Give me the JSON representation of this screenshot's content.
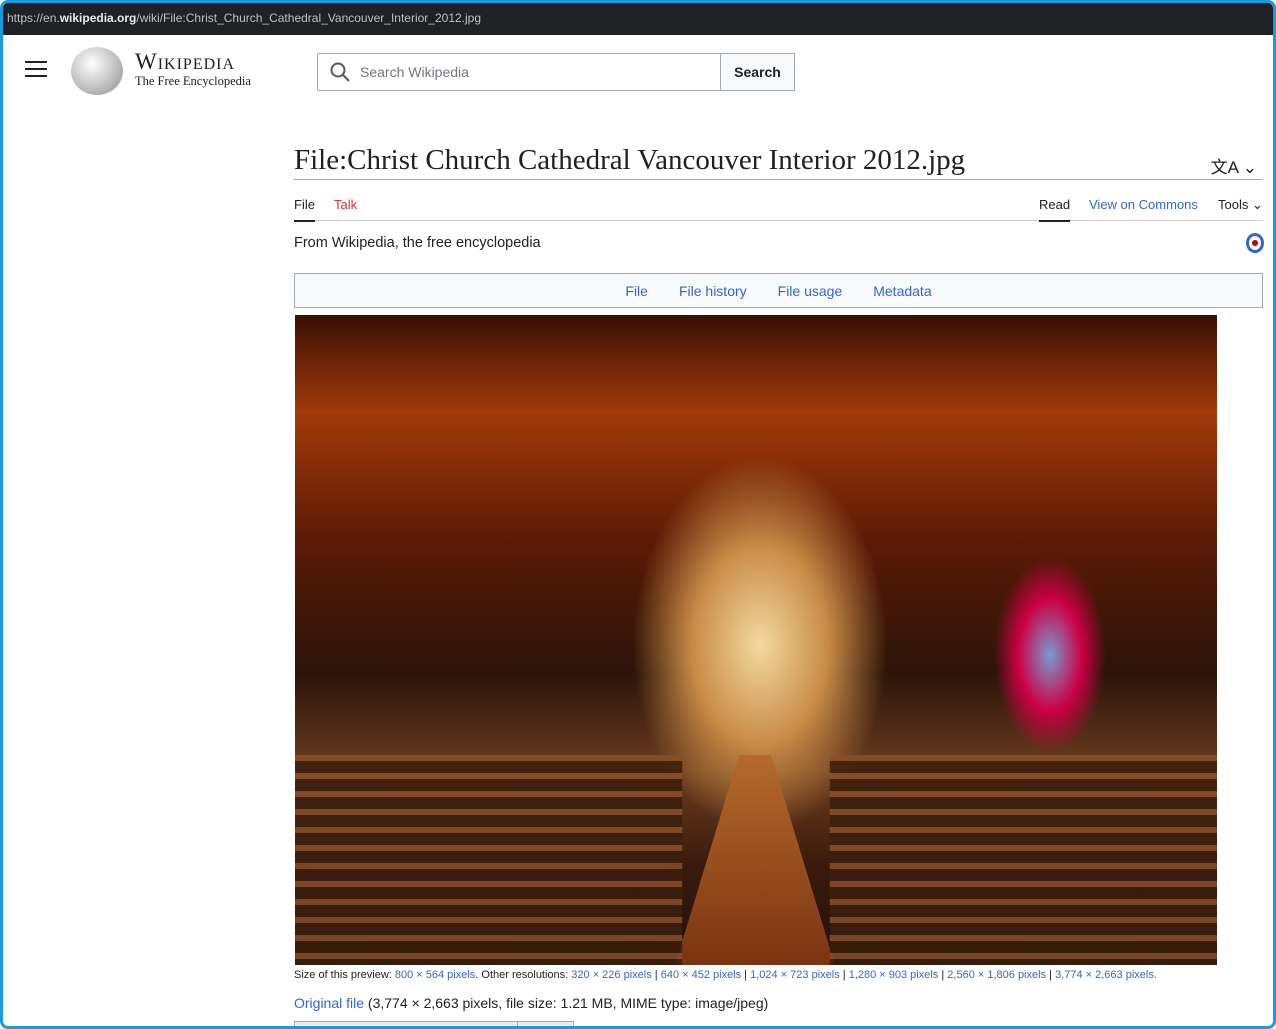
{
  "browser": {
    "url_prefix": "https://en.",
    "url_domain": "wikipedia.org",
    "url_path": "/wiki/File:Christ_Church_Cathedral_Vancouver_Interior_2012.jpg"
  },
  "header": {
    "wordmark": "Wikipedia",
    "tagline": "The Free Encyclopedia",
    "search_placeholder": "Search Wikipedia",
    "search_button": "Search"
  },
  "page": {
    "title": "File:Christ Church Cathedral Vancouver Interior 2012.jpg",
    "lang_icon": "文A",
    "tabs_left": [
      "File",
      "Talk"
    ],
    "tabs_right": [
      "Read",
      "View on Commons",
      "Tools"
    ],
    "from": "From Wikipedia, the free encyclopedia"
  },
  "file_toc": [
    "File",
    "File history",
    "File usage",
    "Metadata"
  ],
  "caption": {
    "prefix": "Size of this preview: ",
    "preview": "800 × 564 pixels",
    "mid": ". Other resolutions: ",
    "resolutions": [
      "320 × 226 pixels",
      "640 × 452 pixels",
      "1,024 × 723 pixels",
      "1,280 × 903 pixels",
      "2,560 × 1,806 pixels",
      "3,774 × 2,663 pixels"
    ],
    "sep": " | ",
    "end": "."
  },
  "original": {
    "link": "Original file",
    "details": " (3,774 × 2,663 pixels, file size: 1.21 MB, MIME type: image/jpeg)"
  }
}
